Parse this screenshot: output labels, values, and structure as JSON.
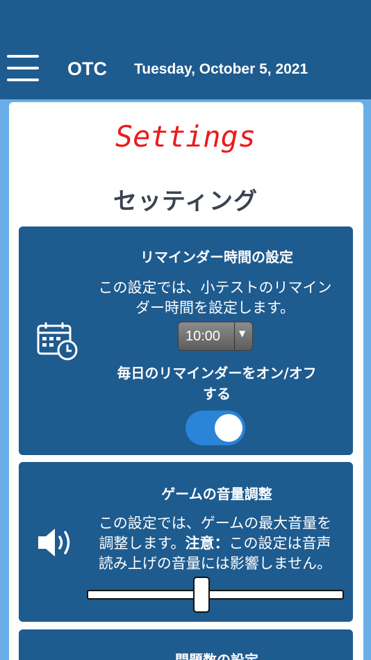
{
  "header": {
    "menu_icon": "hamburger-menu-icon",
    "app_title": "OTC",
    "date": "Tuesday, October 5, 2021"
  },
  "page": {
    "title_en": "Settings",
    "title_jp": "セッティング"
  },
  "reminder": {
    "title": "リマインダー時間の設定",
    "desc_line1": "この設定では、小テストのリマイン",
    "desc_line2": "ダー時間を設定します。",
    "time_value": "10:00",
    "toggle_label_line1": "毎日のリマインダーをオン/オフ",
    "toggle_label_line2": "する",
    "toggle_on": true,
    "icon": "calendar-clock-icon"
  },
  "volume": {
    "title": "ゲームの音量調整",
    "desc_line1": "この設定では、ゲームの最大音量を",
    "desc_line2a": "調整します。",
    "desc_note": "注意：",
    "desc_line2b": "この設定は音声",
    "desc_line3": "読み上げの音量には影響しません。",
    "slider_fraction": 0.44,
    "icon": "speaker-icon"
  },
  "questions": {
    "title": "問題数の設定"
  },
  "colors": {
    "header_bg": "#1e5b8f",
    "page_bg": "#6aaee8",
    "accent_red": "#ea1b1b",
    "toggle_on": "#2a84d8"
  }
}
